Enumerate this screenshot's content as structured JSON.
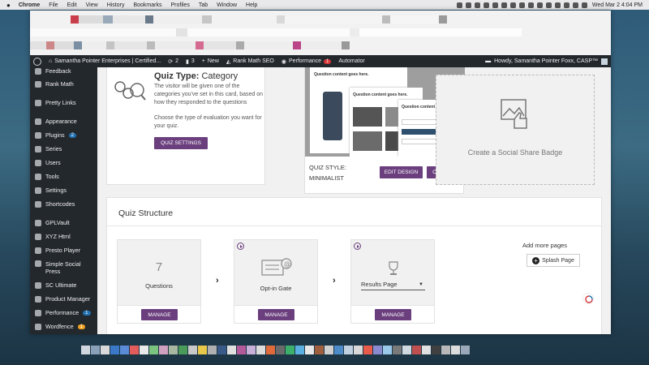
{
  "macbar": {
    "app": "Chrome",
    "menus": [
      "File",
      "Edit",
      "View",
      "History",
      "Bookmarks",
      "Profiles",
      "Tab",
      "Window",
      "Help"
    ],
    "datetime": "Wed Mar 2  4:04 PM"
  },
  "adminbar": {
    "site": "Samantha Pointer Enterprises | Certified...",
    "updates": "2",
    "comments": "3",
    "new": "New",
    "seo": "Rank Math SEO",
    "performance": "Performance",
    "performance_badge": "1",
    "automator": "Automator",
    "howdy": "Howdy, Samantha Pointer Foxx, CASP™"
  },
  "sidebar": {
    "items": [
      {
        "label": "Feedback",
        "badge": ""
      },
      {
        "label": "Rank Math",
        "badge": ""
      },
      {
        "label": "Pretty Links",
        "badge": ""
      },
      {
        "label": "Appearance",
        "badge": ""
      },
      {
        "label": "Plugins",
        "badge": "2"
      },
      {
        "label": "Series",
        "badge": ""
      },
      {
        "label": "Users",
        "badge": ""
      },
      {
        "label": "Tools",
        "badge": ""
      },
      {
        "label": "Settings",
        "badge": ""
      },
      {
        "label": "Shortcodes",
        "badge": ""
      },
      {
        "label": "GPLVault",
        "badge": ""
      },
      {
        "label": "XYZ Html",
        "badge": ""
      },
      {
        "label": "Presto Player",
        "badge": ""
      },
      {
        "label": "Simple Social",
        "label2": "Press",
        "badge": ""
      },
      {
        "label": "SC Ultimate",
        "badge": ""
      },
      {
        "label": "Product Manager",
        "badge": ""
      },
      {
        "label": "Performance",
        "badge": "1"
      },
      {
        "label": "Wordfence",
        "badge": "1"
      }
    ]
  },
  "quiz_type": {
    "title_prefix": "Quiz Type:",
    "title_value": "Category",
    "desc": "The visitor will be given one of the categories you've set in this card, based on how they responded to the questions",
    "choose": "Choose the type of evaluation you want for your quiz.",
    "button": "QUIZ SETTINGS"
  },
  "quiz_style": {
    "preview_heading1": "Question content goes here.",
    "preview_heading2": "Question content goes here.",
    "preview_heading3": "Question content goes here.",
    "label_line1": "QUIZ STYLE:",
    "label_line2": "MINIMALIST",
    "edit_button": "EDIT DESIGN",
    "change_button": "CHANGE"
  },
  "social": {
    "text": "Create a Social Share Badge"
  },
  "structure": {
    "title": "Quiz Structure",
    "questions_count": "7",
    "questions_label": "Questions",
    "optin_label": "Opt-in Gate",
    "results_label": "Results Page",
    "manage": "MANAGE",
    "add_more": "Add more pages",
    "splash": "Splash Page"
  },
  "colors": {
    "accent": "#6b3f7e",
    "admin_bg": "#23282d"
  }
}
